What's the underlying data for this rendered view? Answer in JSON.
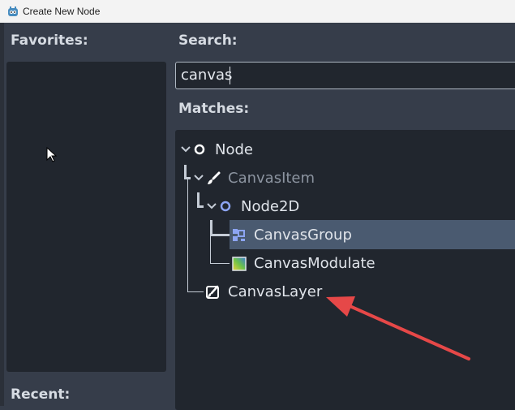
{
  "window": {
    "title": "Create New Node"
  },
  "favorites": {
    "label": "Favorites:"
  },
  "search": {
    "label": "Search:",
    "value": "canvas"
  },
  "matches": {
    "label": "Matches:",
    "items": [
      {
        "label": "Node",
        "icon": "circle-outline-icon"
      },
      {
        "label": "CanvasItem",
        "icon": "brush-icon"
      },
      {
        "label": "Node2D",
        "icon": "circle-outline-icon"
      },
      {
        "label": "CanvasGroup",
        "icon": "canvas-group-icon",
        "selected": true
      },
      {
        "label": "CanvasModulate",
        "icon": "canvas-modulate-icon"
      },
      {
        "label": "CanvasLayer",
        "icon": "canvas-layer-icon"
      }
    ]
  },
  "recent": {
    "label": "Recent:"
  },
  "colors": {
    "background": "#363d4a",
    "panel": "#21262e",
    "selected": "#4a5a70",
    "annotation_arrow": "#e64848",
    "node2d_blue": "#8da5f3"
  }
}
